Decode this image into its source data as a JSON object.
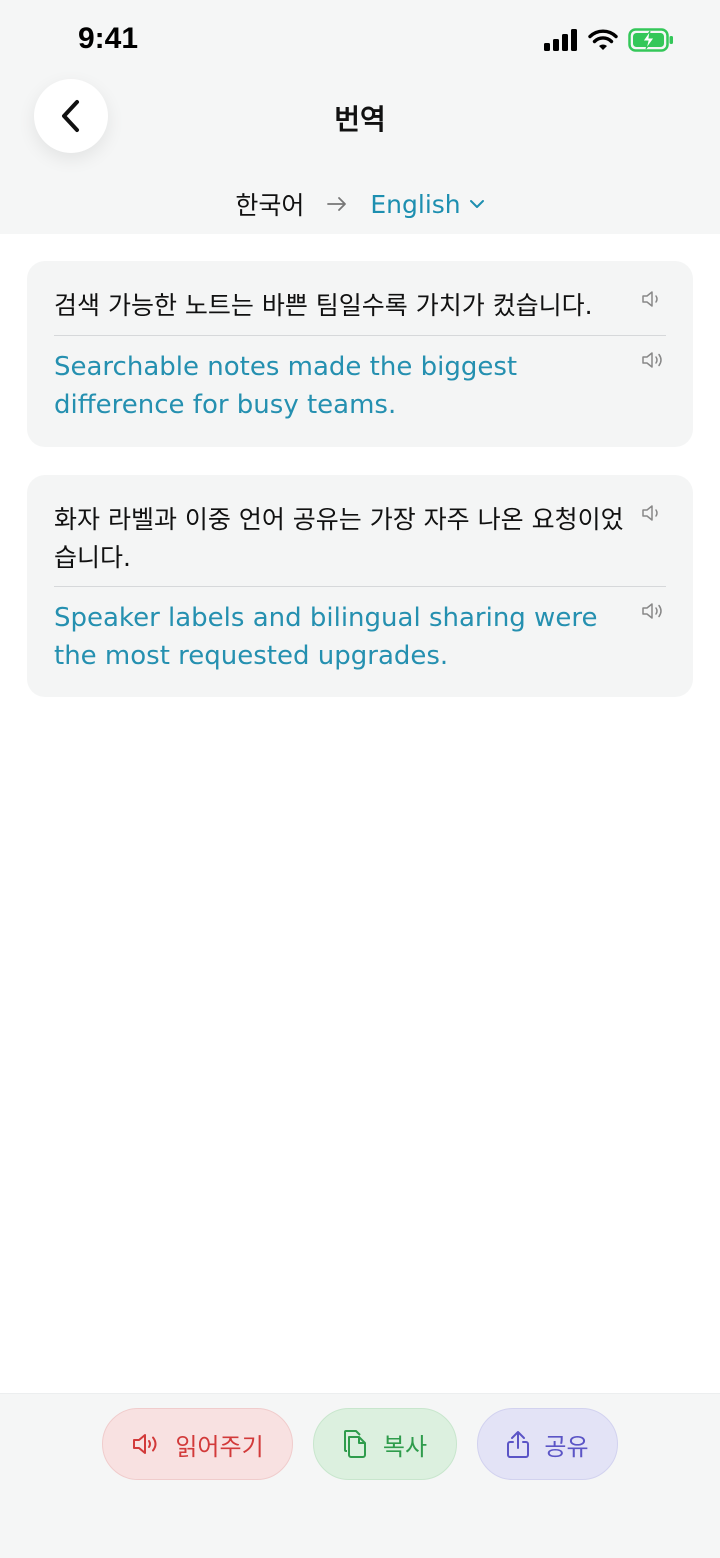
{
  "status": {
    "time": "9:41"
  },
  "header": {
    "title": "번역",
    "source_lang": "한국어",
    "target_lang": "English"
  },
  "segments": [
    {
      "source": "검색 가능한 노트는 바쁜 팀일수록 가치가 컸습니다.",
      "translation": "Searchable notes made the biggest difference for busy teams."
    },
    {
      "source": "화자 라벨과 이중 언어 공유는 가장 자주 나온 요청이었습니다.",
      "translation": "Speaker labels and bilingual sharing were the most requested upgrades."
    }
  ],
  "actions": {
    "read": "읽어주기",
    "copy": "복사",
    "share": "공유"
  },
  "colors": {
    "accent": "#1d8fb0",
    "read": "#d23a3a",
    "copy": "#2f9c4c",
    "share": "#5b55c6",
    "battery": "#34c759"
  }
}
